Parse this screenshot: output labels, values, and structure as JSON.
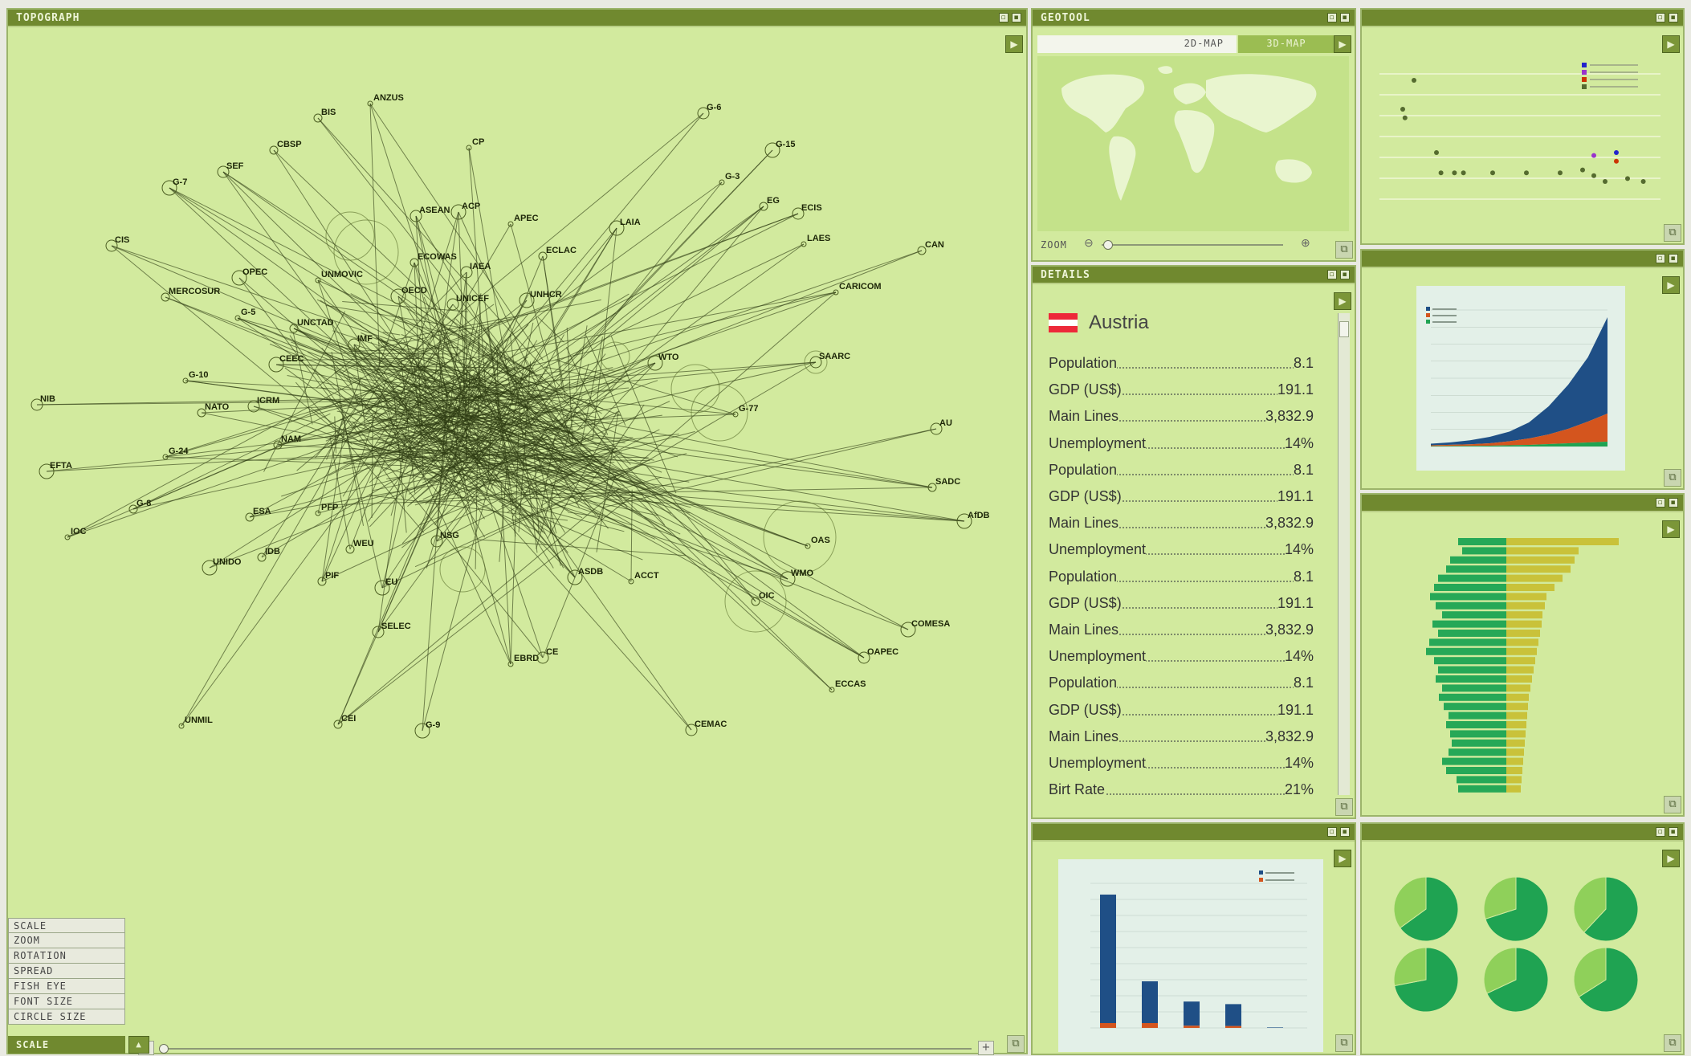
{
  "topograph": {
    "title": "TOPOGRAPH",
    "menu_items": [
      "SCALE",
      "ZOOM",
      "ROTATION",
      "SPREAD",
      "FISH EYE",
      "FONT SIZE",
      "CIRCLE SIZE"
    ],
    "selected_tool": "SCALE",
    "nodes": [
      {
        "label": "ANZUS"
      },
      {
        "label": "BIS"
      },
      {
        "label": "G-6"
      },
      {
        "label": "G-15"
      },
      {
        "label": "CP"
      },
      {
        "label": "CBSP"
      },
      {
        "label": "SEF"
      },
      {
        "label": "G-7"
      },
      {
        "label": "G-3"
      },
      {
        "label": "EG"
      },
      {
        "label": "ECIS"
      },
      {
        "label": "LAIA"
      },
      {
        "label": "LAES"
      },
      {
        "label": "CAN"
      },
      {
        "label": "ASEAN"
      },
      {
        "label": "ACP"
      },
      {
        "label": "APEC"
      },
      {
        "label": "ECLAC"
      },
      {
        "label": "CIS"
      },
      {
        "label": "OPEC"
      },
      {
        "label": "UNMOVIC"
      },
      {
        "label": "ECOWAS"
      },
      {
        "label": "IAEA"
      },
      {
        "label": "OECD"
      },
      {
        "label": "CARICOM"
      },
      {
        "label": "MERCOSUR"
      },
      {
        "label": "UNICEF"
      },
      {
        "label": "UNHCR"
      },
      {
        "label": "G-5"
      },
      {
        "label": "UNCTAD"
      },
      {
        "label": "IMF"
      },
      {
        "label": "CEEC"
      },
      {
        "label": "G-10"
      },
      {
        "label": "NATO"
      },
      {
        "label": "ICRM"
      },
      {
        "label": "EFTA"
      },
      {
        "label": "G-24"
      },
      {
        "label": "G-8"
      },
      {
        "label": "NIB"
      },
      {
        "label": "WTO"
      },
      {
        "label": "G-77"
      },
      {
        "label": "NAM"
      },
      {
        "label": "AU"
      },
      {
        "label": "AfDB"
      },
      {
        "label": "OAS"
      },
      {
        "label": "IDB"
      },
      {
        "label": "OAPEC"
      },
      {
        "label": "COMESA"
      },
      {
        "label": "ECCAS"
      },
      {
        "label": "SADC"
      },
      {
        "label": "SAARC"
      },
      {
        "label": "ASDB"
      },
      {
        "label": "ACCT"
      },
      {
        "label": "OIC"
      },
      {
        "label": "CEMAC"
      },
      {
        "label": "UNIDO"
      },
      {
        "label": "UNMIL"
      },
      {
        "label": "PIF"
      },
      {
        "label": "SELEC"
      },
      {
        "label": "EU"
      },
      {
        "label": "EBRD"
      },
      {
        "label": "ESA"
      },
      {
        "label": "CE"
      },
      {
        "label": "G-9"
      },
      {
        "label": "PFP"
      },
      {
        "label": "WEU"
      },
      {
        "label": "NSG"
      },
      {
        "label": "WMO"
      },
      {
        "label": "IOC"
      },
      {
        "label": "CEI"
      }
    ]
  },
  "geotool": {
    "title": "GEOTOOL",
    "tabs": [
      "2D-MAP",
      "3D-MAP"
    ],
    "active_tab": "2D-MAP",
    "zoom_label": "ZOOM"
  },
  "details": {
    "title": "DETAILS",
    "country": "Austria",
    "flag_colors": [
      "#ed2939",
      "#ffffff",
      "#ed2939"
    ],
    "rows": [
      {
        "label": "Population",
        "value": "8.1"
      },
      {
        "label": "GDP (US$)",
        "value": "191.1"
      },
      {
        "label": "Main Lines",
        "value": "3,832.9"
      },
      {
        "label": "Unemployment",
        "value": "14%"
      },
      {
        "label": "Population",
        "value": "8.1"
      },
      {
        "label": "GDP (US$)",
        "value": "191.1"
      },
      {
        "label": "Main Lines",
        "value": "3,832.9"
      },
      {
        "label": "Unemployment",
        "value": "14%"
      },
      {
        "label": "Population",
        "value": "8.1"
      },
      {
        "label": "GDP (US$)",
        "value": "191.1"
      },
      {
        "label": "Main Lines",
        "value": "3,832.9"
      },
      {
        "label": "Unemployment",
        "value": "14%"
      },
      {
        "label": "Population",
        "value": "8.1"
      },
      {
        "label": "GDP (US$)",
        "value": "191.1"
      },
      {
        "label": "Main Lines",
        "value": "3,832.9"
      },
      {
        "label": "Unemployment",
        "value": "14%"
      },
      {
        "label": "Birt Rate",
        "value": "21%"
      }
    ]
  },
  "colors": {
    "panel_bg": "#d2ea9e",
    "titlebar": "#70892f",
    "accent_blue": "#1f4f86",
    "accent_orange": "#d4551e",
    "accent_green": "#1fa352"
  },
  "chart_data": [
    {
      "type": "scatter",
      "legend_position": "top-right",
      "series": [
        {
          "color": "#2222cc",
          "points": [
            [
              1,
              2.0
            ]
          ]
        },
        {
          "color": "#9933cc",
          "points": [
            [
              0.9,
              1.9
            ]
          ]
        },
        {
          "color": "#cc3300",
          "points": [
            [
              1.0,
              1.7
            ]
          ]
        },
        {
          "color": "#556b2f",
          "points": [
            [
              0.1,
              4.5
            ],
            [
              0.05,
              3.5
            ],
            [
              0.06,
              3.2
            ],
            [
              0.2,
              2.0
            ],
            [
              0.22,
              1.3
            ],
            [
              0.28,
              1.3
            ],
            [
              0.32,
              1.3
            ],
            [
              0.45,
              1.3
            ],
            [
              0.6,
              1.3
            ],
            [
              0.75,
              1.3
            ],
            [
              0.85,
              1.4
            ],
            [
              0.9,
              1.2
            ],
            [
              0.95,
              1.0
            ],
            [
              1.05,
              1.1
            ],
            [
              1.12,
              1.0
            ]
          ]
        }
      ]
    },
    {
      "type": "area",
      "legend_position": "top-left",
      "x": [
        1,
        2,
        3,
        4,
        5,
        6,
        7,
        8,
        9,
        10
      ],
      "series": [
        {
          "color": "#1f4f86",
          "values": [
            2,
            3,
            5,
            8,
            12,
            20,
            35,
            55,
            80,
            120
          ]
        },
        {
          "color": "#d4551e",
          "values": [
            1,
            1.5,
            2,
            3,
            5,
            8,
            12,
            18,
            26,
            35
          ]
        },
        {
          "color": "#1fa352",
          "values": [
            0.5,
            0.6,
            0.8,
            1,
            1.5,
            2,
            3,
            4,
            5,
            6
          ]
        }
      ]
    },
    {
      "type": "bar",
      "orientation": "horizontal-diverging",
      "series": [
        {
          "color": "#26a857",
          "values": [
            60,
            55,
            70,
            75,
            85,
            90,
            95,
            88,
            80,
            92,
            85,
            96,
            100,
            90,
            85,
            88,
            80,
            84,
            78,
            72,
            75,
            70,
            68,
            72,
            80,
            75,
            62,
            60
          ]
        },
        {
          "color": "#c9c23a",
          "values": [
            140,
            90,
            85,
            80,
            70,
            60,
            50,
            48,
            45,
            44,
            42,
            40,
            38,
            36,
            34,
            32,
            30,
            28,
            27,
            26,
            25,
            24,
            23,
            22,
            21,
            20,
            19,
            18
          ]
        }
      ]
    },
    {
      "type": "bar",
      "stacked": true,
      "categories": [
        "",
        "",
        "",
        "",
        ""
      ],
      "series": [
        {
          "color": "#1f4f86",
          "values": [
            40000,
            13000,
            7500,
            6800,
            150
          ]
        },
        {
          "color": "#d4551e",
          "values": [
            1500,
            1500,
            700,
            600,
            0
          ]
        }
      ],
      "ylim": [
        0,
        45000
      ],
      "legend_position": "top-right"
    },
    {
      "type": "pie",
      "charts": [
        {
          "slices": [
            {
              "value": 65,
              "color": "#1fa352"
            },
            {
              "value": 35,
              "color": "#8fd05a"
            }
          ]
        },
        {
          "slices": [
            {
              "value": 70,
              "color": "#1fa352"
            },
            {
              "value": 30,
              "color": "#8fd05a"
            }
          ]
        },
        {
          "slices": [
            {
              "value": 62,
              "color": "#1fa352"
            },
            {
              "value": 38,
              "color": "#8fd05a"
            }
          ]
        },
        {
          "slices": [
            {
              "value": 72,
              "color": "#1fa352"
            },
            {
              "value": 28,
              "color": "#8fd05a"
            }
          ]
        },
        {
          "slices": [
            {
              "value": 68,
              "color": "#1fa352"
            },
            {
              "value": 32,
              "color": "#8fd05a"
            }
          ]
        },
        {
          "slices": [
            {
              "value": 66,
              "color": "#1fa352"
            },
            {
              "value": 34,
              "color": "#8fd05a"
            }
          ]
        }
      ]
    }
  ]
}
